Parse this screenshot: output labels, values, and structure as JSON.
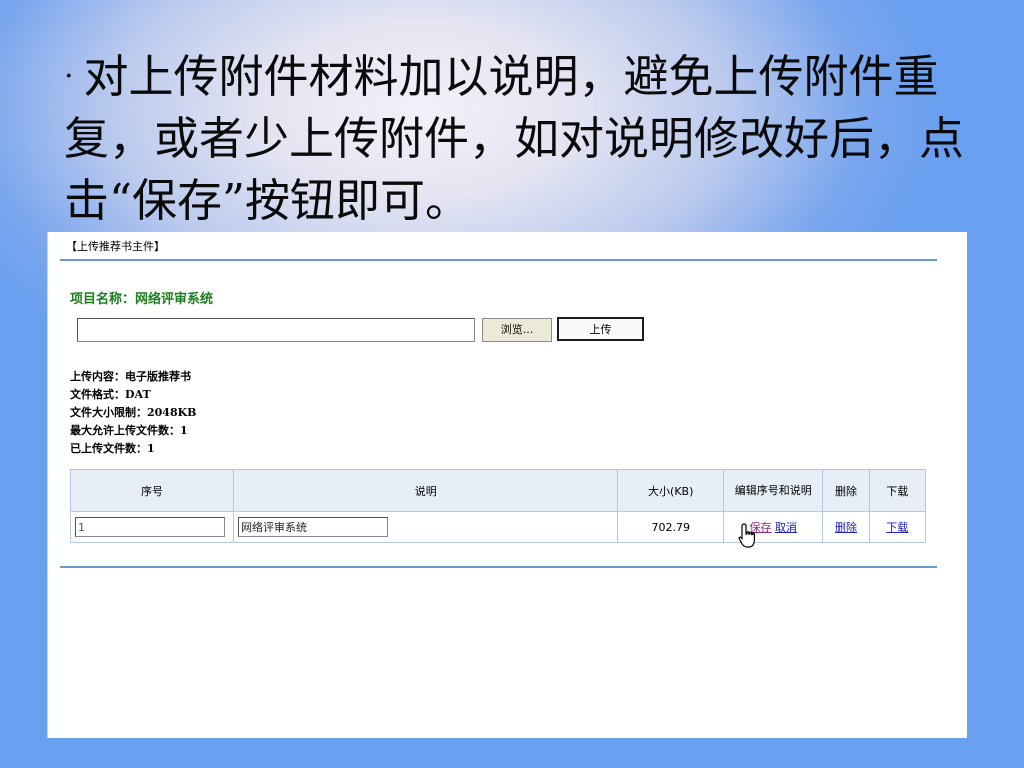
{
  "slide": {
    "bullet": "·",
    "text": "对上传附件材料加以说明，避免上传附件重复，或者少上传附件，如对说明修改好后，点击“保存”按钮即可。"
  },
  "panel": {
    "title": "【上传推荐书主件】",
    "project_label": "项目名称：网络评审系统",
    "browse_label": "浏览...",
    "upload_label": "上传",
    "info": [
      "上传内容：电子版推荐书",
      "文件格式：DAT",
      "文件大小限制：2048KB",
      "最大允许上传文件数：1",
      "已上传文件数：1"
    ],
    "table": {
      "headers": [
        "序号",
        "说明",
        "大小(KB)",
        "编辑序号和说明",
        "删除",
        "下载"
      ],
      "row": {
        "seq": "1",
        "desc": "网络评审系统",
        "size": "702.79",
        "save": "保存",
        "cancel": "取消",
        "delete": "删除",
        "download": "下载"
      }
    }
  },
  "colors": {
    "accent_green": "#1e7d1e",
    "link_blue": "#2020c0",
    "rule_blue": "#6a9ac8"
  }
}
